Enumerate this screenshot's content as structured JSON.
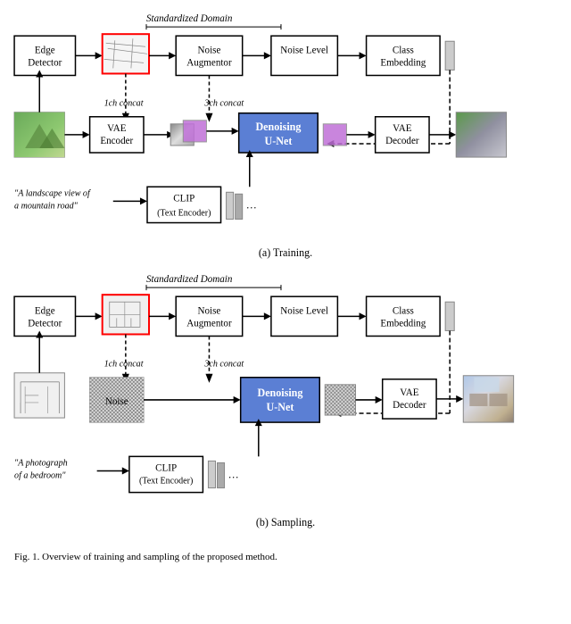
{
  "diagrams": {
    "training": {
      "domain_label": "Standardized Domain",
      "caption": "(a) Training.",
      "boxes": {
        "edge_detector": "Edge\nDetector",
        "noise_augmentor": "Noise\nAugmentor",
        "noise_level": "Noise Level",
        "class_embedding": "Class\nEmbedding",
        "vae_encoder": "VAE\nEncoder",
        "denoising_unet": "Denoising\nU-Net",
        "vae_decoder": "VAE\nDecoder",
        "clip": "CLIP\n(Text Encoder)"
      },
      "labels": {
        "ch1_concat": "1ch concat",
        "ch3_concat": "3ch concat"
      },
      "text_prompt": "\"A landscape view of\na mountain road\""
    },
    "sampling": {
      "domain_label": "Standardized Domain",
      "caption": "(b) Sampling.",
      "boxes": {
        "edge_detector": "Edge\nDetector",
        "noise_augmentor": "Noise\nAugmentor",
        "noise_level": "Noise Level",
        "class_embedding": "Class\nEmbedding",
        "denoising_unet": "Denoising\nU-Net",
        "vae_decoder": "VAE\nDecoder",
        "clip": "CLIP\n(Text Encoder)",
        "noise": "Noise"
      },
      "labels": {
        "ch1_concat": "1ch concat",
        "ch3_concat": "3ch concat"
      },
      "text_prompt": "\"A photograph\nof a bedroom\""
    },
    "figure_caption": "Fig. 1. Overview of training and sampling of the proposed method."
  }
}
